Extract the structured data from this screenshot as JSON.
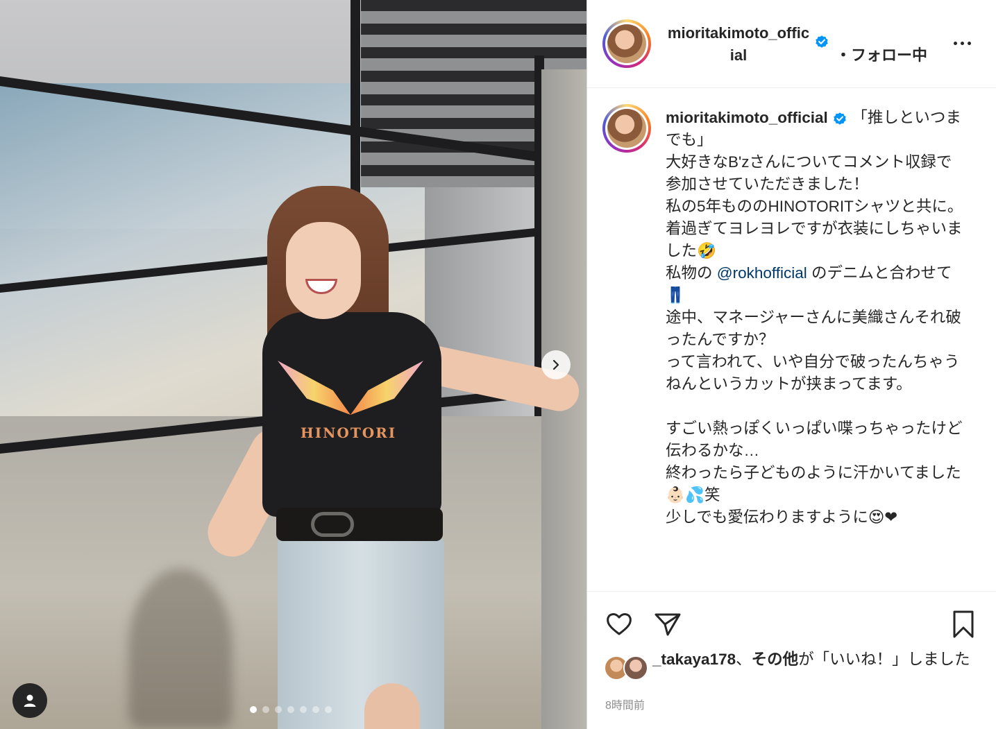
{
  "post": {
    "author": {
      "username_header": "mioritakimoto_official",
      "username_caption": "mioritakimoto_official",
      "verified": true,
      "follow_status": "・フォロー中"
    },
    "caption_lines": [
      "「推しといつまでも」",
      "大好きなB'zさんについてコメント収録で参加させていただきました！",
      "私の5年もののHINOTORITシャツと共に。",
      "着過ぎてヨレヨレですが衣装にしちゃいました🤣",
      "私物の ",
      "@rokhofficial",
      " のデニムと合わせて👖",
      "途中、マネージャーさんに美織さんそれ破ったんですか？",
      "って言われて、いや自分で破ったんちゃうねんというカットが挟まってます。",
      "",
      "すごい熱っぽくいっぱい喋っちゃったけど伝わるかな…",
      "終わったら子どものように汗かいてました👶🏻💦笑",
      "少しでも愛伝わりますように😍❤"
    ],
    "likes": {
      "first_liker": "_takaya178",
      "separator": "、",
      "others": "その他",
      "suffix": "が「いいね！」しました"
    },
    "time_ago": "8時間前",
    "photo": {
      "shirt_print": "HINOTORI",
      "carousel_index": 1,
      "carousel_total": 7
    }
  },
  "icons": {
    "like": "heart-icon",
    "share": "send-icon",
    "save": "bookmark-icon",
    "more": "more-dots-icon",
    "next": "chevron-right-icon",
    "tags": "user-tag-icon",
    "verified": "verified-badge-icon"
  },
  "colors": {
    "text": "#262626",
    "muted": "#8e8e8e",
    "link": "#00376b",
    "verified": "#0095f6"
  }
}
